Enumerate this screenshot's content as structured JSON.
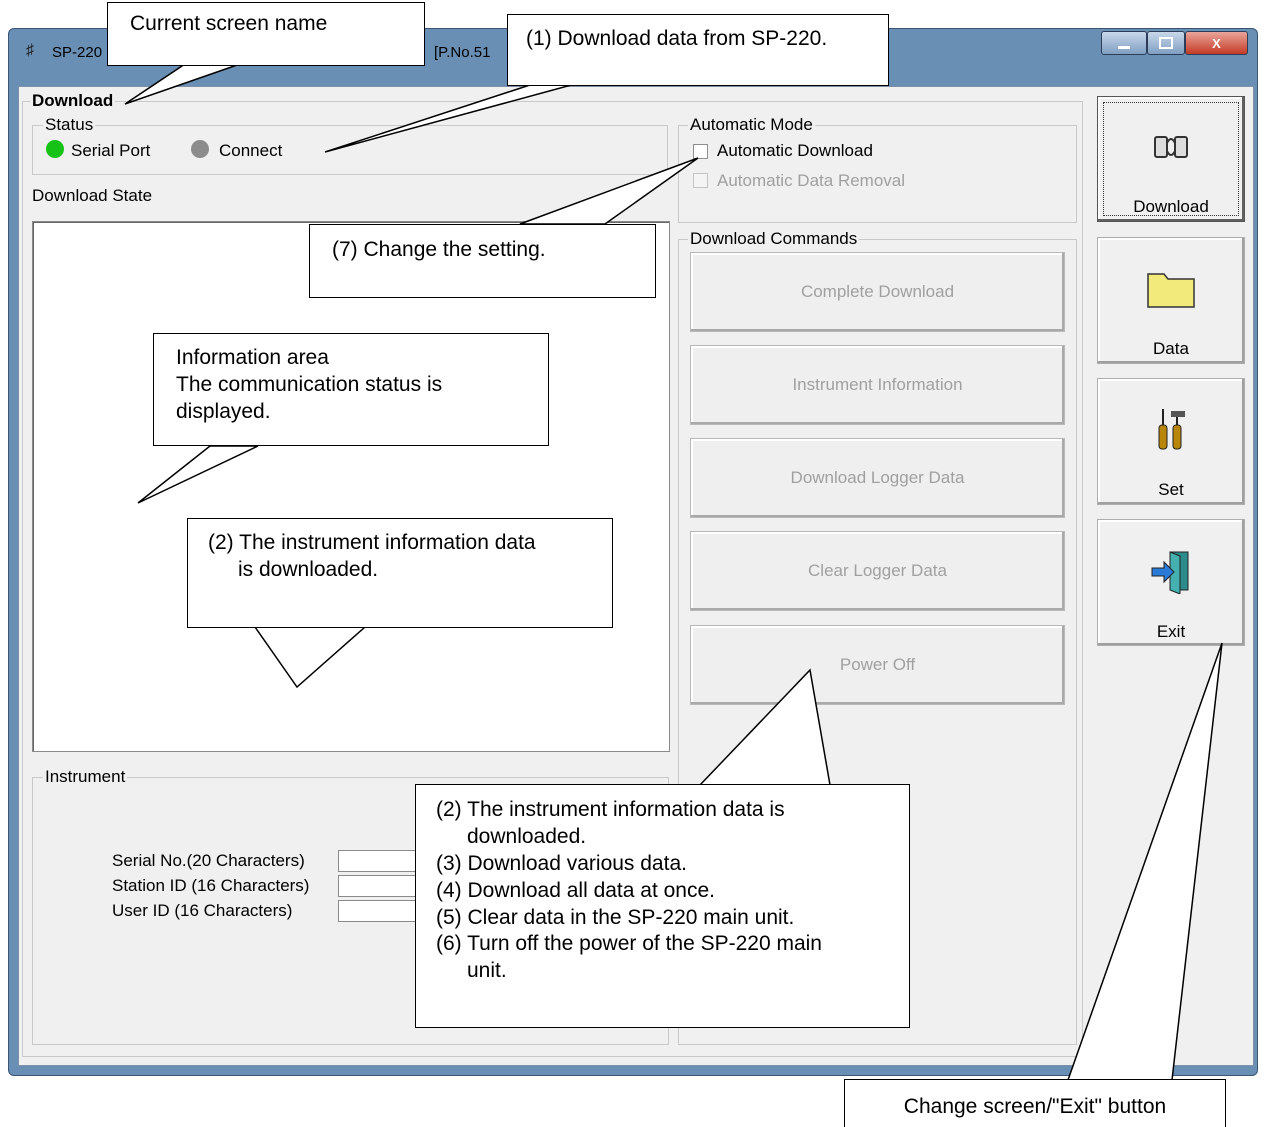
{
  "window": {
    "title_visible": "SP-220",
    "title_fragment": "[P.No.51",
    "buttons": {
      "close_glyph": "X"
    }
  },
  "screen": {
    "name": "Download",
    "status": {
      "legend": "Status",
      "serial_port_label": "Serial Port",
      "serial_port_color": "#16c216",
      "connect_label": "Connect",
      "connect_color": "#8c8c8c"
    },
    "download_state_label": "Download State",
    "automatic_mode": {
      "legend": "Automatic Mode",
      "automatic_download_label": "Automatic Download",
      "automatic_download_checked": false,
      "automatic_data_removal_label": "Automatic Data Removal",
      "automatic_data_removal_enabled": false
    },
    "download_commands": {
      "legend": "Download Commands",
      "buttons": [
        {
          "label": "Complete Download"
        },
        {
          "label": "Instrument Information"
        },
        {
          "label": "Download Logger Data"
        },
        {
          "label": "Clear Logger Data"
        },
        {
          "label": "Power Off"
        }
      ]
    },
    "instrument": {
      "legend": "Instrument",
      "fields": [
        {
          "label": "Serial No.(20 Characters)",
          "value": ""
        },
        {
          "label": "Station ID (16 Characters)",
          "value": ""
        },
        {
          "label": "User ID (16 Characters)",
          "value": ""
        }
      ]
    }
  },
  "side_nav": [
    {
      "label": "Download",
      "icon": "download-icon"
    },
    {
      "label": "Data",
      "icon": "folder-icon"
    },
    {
      "label": "Set",
      "icon": "tools-icon"
    },
    {
      "label": "Exit",
      "icon": "exit-door-icon"
    }
  ],
  "callouts": {
    "screen_name": "Current screen name",
    "download_data": "(1) Download data from SP-220.",
    "change_setting": "(7) Change the setting.",
    "info_area": [
      "Information area",
      "The communication status is",
      "displayed."
    ],
    "instrument_info": [
      "(2) The instrument information data",
      "is downloaded."
    ],
    "commands": [
      "(2) The instrument information data is",
      "downloaded.",
      "(3) Download various data.",
      "(4) Download all data at once.",
      "(5) Clear data in the SP-220 main unit.",
      "(6) Turn off the power of the SP-220 main",
      "unit."
    ],
    "exit_button": "Change screen/\"Exit\" button"
  }
}
